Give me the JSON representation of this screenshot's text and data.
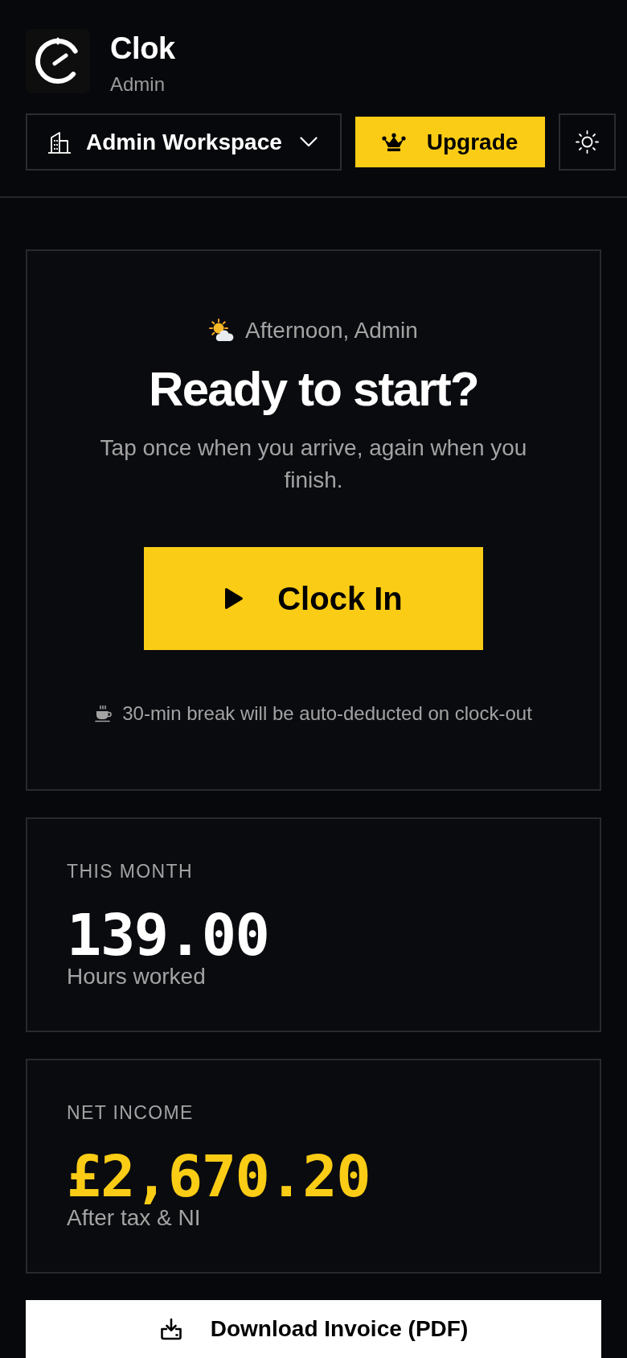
{
  "header": {
    "app_name": "Clok",
    "role": "Admin",
    "workspace": "Admin Workspace",
    "upgrade_button": "Upgrade"
  },
  "clock_card": {
    "greeting": "Afternoon, Admin",
    "title": "Ready to start?",
    "subtitle": "Tap once when you arrive, again when you finish.",
    "clock_in_button": "Clock In",
    "break_note": "30-min break will be auto-deducted on clock-out"
  },
  "stats": [
    {
      "kind": "hours",
      "label": "THIS MONTH",
      "value": "139.00",
      "caption": "Hours worked"
    },
    {
      "kind": "money",
      "label": "NET INCOME",
      "value": "£2,670.20",
      "caption": "After tax & NI"
    }
  ],
  "download_button": "Download Invoice (PDF)"
}
